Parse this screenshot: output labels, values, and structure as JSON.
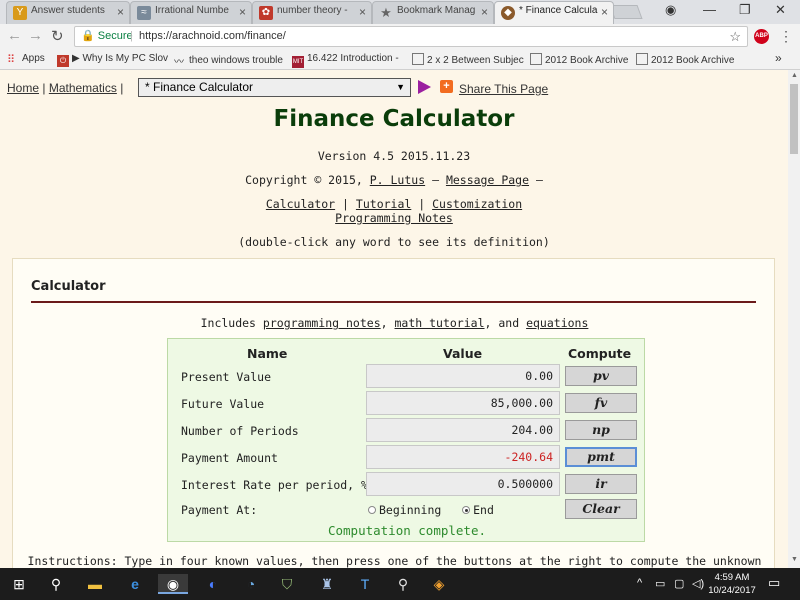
{
  "browser": {
    "tabs": [
      {
        "label": "Answer students",
        "icon": "answer-icon",
        "color": "#d99a1a",
        "active": false
      },
      {
        "label": "Irrational Numbe",
        "icon": "irrational-icon",
        "color": "#7a8a9a",
        "active": false
      },
      {
        "label": "number theory -",
        "icon": "gear-icon",
        "color": "#c0392b",
        "active": false
      },
      {
        "label": "Bookmark Manag",
        "icon": "star-icon",
        "color": "#666666",
        "active": false
      },
      {
        "label": "* Finance Calcula",
        "icon": "arachnoid-icon",
        "color": "#8b5a2b",
        "active": true
      }
    ],
    "address": {
      "secure_label": "Secure",
      "url": "https://arachnoid.com/finance/",
      "separator": "|"
    },
    "bookmarks": [
      {
        "label": "Apps",
        "icon": "apps-icon"
      },
      {
        "label": "▶ Why Is My PC Slov",
        "icon": "power-icon"
      },
      {
        "label": "theo windows trouble",
        "icon": "wave-icon"
      },
      {
        "label": "16.422 Introduction -",
        "icon": "mit-icon"
      },
      {
        "label": "2 x 2 Between Subjec",
        "icon": "page-icon"
      },
      {
        "label": "2012 Book Archive",
        "icon": "page-icon"
      },
      {
        "label": "2012 Book Archive",
        "icon": "page-icon"
      }
    ],
    "more_bookmarks": "»",
    "abp_label": "ABP"
  },
  "page": {
    "nav": {
      "home": "Home",
      "sep1": "|",
      "math": "Mathematics",
      "sep2": "|"
    },
    "calc_select": "* Finance Calculator",
    "share": "Share This Page",
    "title": "Finance Calculator",
    "version": "Version 4.5 2015.11.23",
    "copyright_prefix": "Copyright © 2015,",
    "author": "P. Lutus",
    "dash": "—",
    "message_page": "Message Page",
    "links": {
      "calculator": "Calculator",
      "tutorial": "Tutorial",
      "customization": "Customization",
      "programming": "Programming Notes",
      "sep": "|"
    },
    "dblclick_hint": "(double-click any word to see its definition)",
    "card": {
      "heading": "Calculator",
      "includes_prefix": "Includes",
      "link1": "programming notes",
      "link2": "math tutorial",
      "link3": "equations",
      "comma": ",",
      "and": ", and"
    },
    "calc": {
      "col_name": "Name",
      "col_value": "Value",
      "col_compute": "Compute",
      "rows": [
        {
          "label": "Present Value",
          "value": "0.00",
          "button": "pv",
          "value_color": "#333333"
        },
        {
          "label": "Future Value",
          "value": "85,000.00",
          "button": "fv",
          "value_color": "#333333"
        },
        {
          "label": "Number of Periods",
          "value": "204.00",
          "button": "np",
          "value_color": "#333333"
        },
        {
          "label": "Payment Amount",
          "value": "-240.64",
          "button": "pmt",
          "value_color": "#cc2222"
        },
        {
          "label": "Interest Rate per period, %",
          "value": "0.500000",
          "button": "ir",
          "value_color": "#333333"
        }
      ],
      "payment_at_label": "Payment At:",
      "opt_beginning": "Beginning",
      "opt_end": "End",
      "selected": "End",
      "clear": "Clear",
      "status": "Computation complete."
    },
    "instructions": "Instructions: Type in four known values, then press one of the buttons at the right to compute the unknown value."
  },
  "taskbar": {
    "time": "4:59 AM",
    "date": "10/24/2017"
  }
}
